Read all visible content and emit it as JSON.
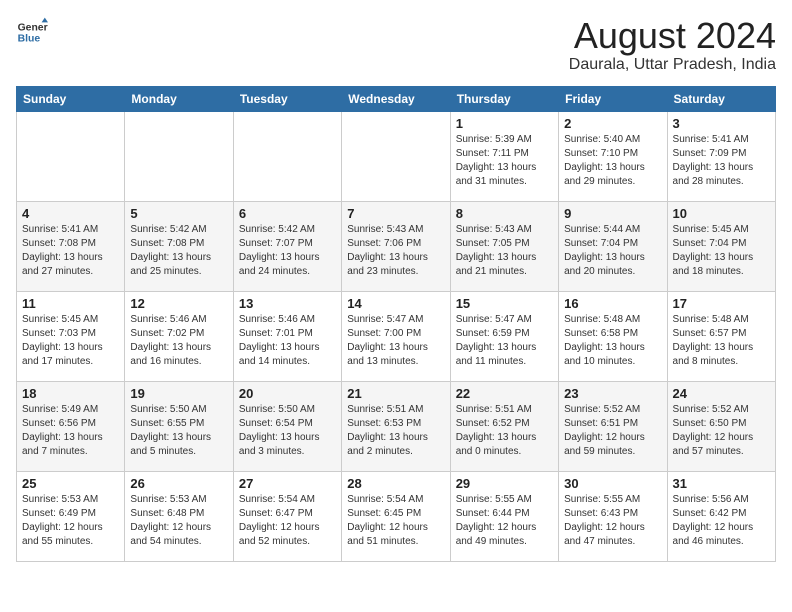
{
  "header": {
    "logo_line1": "General",
    "logo_line2": "Blue",
    "month_year": "August 2024",
    "location": "Daurala, Uttar Pradesh, India"
  },
  "weekdays": [
    "Sunday",
    "Monday",
    "Tuesday",
    "Wednesday",
    "Thursday",
    "Friday",
    "Saturday"
  ],
  "weeks": [
    [
      {
        "day": "",
        "info": ""
      },
      {
        "day": "",
        "info": ""
      },
      {
        "day": "",
        "info": ""
      },
      {
        "day": "",
        "info": ""
      },
      {
        "day": "1",
        "info": "Sunrise: 5:39 AM\nSunset: 7:11 PM\nDaylight: 13 hours\nand 31 minutes."
      },
      {
        "day": "2",
        "info": "Sunrise: 5:40 AM\nSunset: 7:10 PM\nDaylight: 13 hours\nand 29 minutes."
      },
      {
        "day": "3",
        "info": "Sunrise: 5:41 AM\nSunset: 7:09 PM\nDaylight: 13 hours\nand 28 minutes."
      }
    ],
    [
      {
        "day": "4",
        "info": "Sunrise: 5:41 AM\nSunset: 7:08 PM\nDaylight: 13 hours\nand 27 minutes."
      },
      {
        "day": "5",
        "info": "Sunrise: 5:42 AM\nSunset: 7:08 PM\nDaylight: 13 hours\nand 25 minutes."
      },
      {
        "day": "6",
        "info": "Sunrise: 5:42 AM\nSunset: 7:07 PM\nDaylight: 13 hours\nand 24 minutes."
      },
      {
        "day": "7",
        "info": "Sunrise: 5:43 AM\nSunset: 7:06 PM\nDaylight: 13 hours\nand 23 minutes."
      },
      {
        "day": "8",
        "info": "Sunrise: 5:43 AM\nSunset: 7:05 PM\nDaylight: 13 hours\nand 21 minutes."
      },
      {
        "day": "9",
        "info": "Sunrise: 5:44 AM\nSunset: 7:04 PM\nDaylight: 13 hours\nand 20 minutes."
      },
      {
        "day": "10",
        "info": "Sunrise: 5:45 AM\nSunset: 7:04 PM\nDaylight: 13 hours\nand 18 minutes."
      }
    ],
    [
      {
        "day": "11",
        "info": "Sunrise: 5:45 AM\nSunset: 7:03 PM\nDaylight: 13 hours\nand 17 minutes."
      },
      {
        "day": "12",
        "info": "Sunrise: 5:46 AM\nSunset: 7:02 PM\nDaylight: 13 hours\nand 16 minutes."
      },
      {
        "day": "13",
        "info": "Sunrise: 5:46 AM\nSunset: 7:01 PM\nDaylight: 13 hours\nand 14 minutes."
      },
      {
        "day": "14",
        "info": "Sunrise: 5:47 AM\nSunset: 7:00 PM\nDaylight: 13 hours\nand 13 minutes."
      },
      {
        "day": "15",
        "info": "Sunrise: 5:47 AM\nSunset: 6:59 PM\nDaylight: 13 hours\nand 11 minutes."
      },
      {
        "day": "16",
        "info": "Sunrise: 5:48 AM\nSunset: 6:58 PM\nDaylight: 13 hours\nand 10 minutes."
      },
      {
        "day": "17",
        "info": "Sunrise: 5:48 AM\nSunset: 6:57 PM\nDaylight: 13 hours\nand 8 minutes."
      }
    ],
    [
      {
        "day": "18",
        "info": "Sunrise: 5:49 AM\nSunset: 6:56 PM\nDaylight: 13 hours\nand 7 minutes."
      },
      {
        "day": "19",
        "info": "Sunrise: 5:50 AM\nSunset: 6:55 PM\nDaylight: 13 hours\nand 5 minutes."
      },
      {
        "day": "20",
        "info": "Sunrise: 5:50 AM\nSunset: 6:54 PM\nDaylight: 13 hours\nand 3 minutes."
      },
      {
        "day": "21",
        "info": "Sunrise: 5:51 AM\nSunset: 6:53 PM\nDaylight: 13 hours\nand 2 minutes."
      },
      {
        "day": "22",
        "info": "Sunrise: 5:51 AM\nSunset: 6:52 PM\nDaylight: 13 hours\nand 0 minutes."
      },
      {
        "day": "23",
        "info": "Sunrise: 5:52 AM\nSunset: 6:51 PM\nDaylight: 12 hours\nand 59 minutes."
      },
      {
        "day": "24",
        "info": "Sunrise: 5:52 AM\nSunset: 6:50 PM\nDaylight: 12 hours\nand 57 minutes."
      }
    ],
    [
      {
        "day": "25",
        "info": "Sunrise: 5:53 AM\nSunset: 6:49 PM\nDaylight: 12 hours\nand 55 minutes."
      },
      {
        "day": "26",
        "info": "Sunrise: 5:53 AM\nSunset: 6:48 PM\nDaylight: 12 hours\nand 54 minutes."
      },
      {
        "day": "27",
        "info": "Sunrise: 5:54 AM\nSunset: 6:47 PM\nDaylight: 12 hours\nand 52 minutes."
      },
      {
        "day": "28",
        "info": "Sunrise: 5:54 AM\nSunset: 6:45 PM\nDaylight: 12 hours\nand 51 minutes."
      },
      {
        "day": "29",
        "info": "Sunrise: 5:55 AM\nSunset: 6:44 PM\nDaylight: 12 hours\nand 49 minutes."
      },
      {
        "day": "30",
        "info": "Sunrise: 5:55 AM\nSunset: 6:43 PM\nDaylight: 12 hours\nand 47 minutes."
      },
      {
        "day": "31",
        "info": "Sunrise: 5:56 AM\nSunset: 6:42 PM\nDaylight: 12 hours\nand 46 minutes."
      }
    ]
  ]
}
